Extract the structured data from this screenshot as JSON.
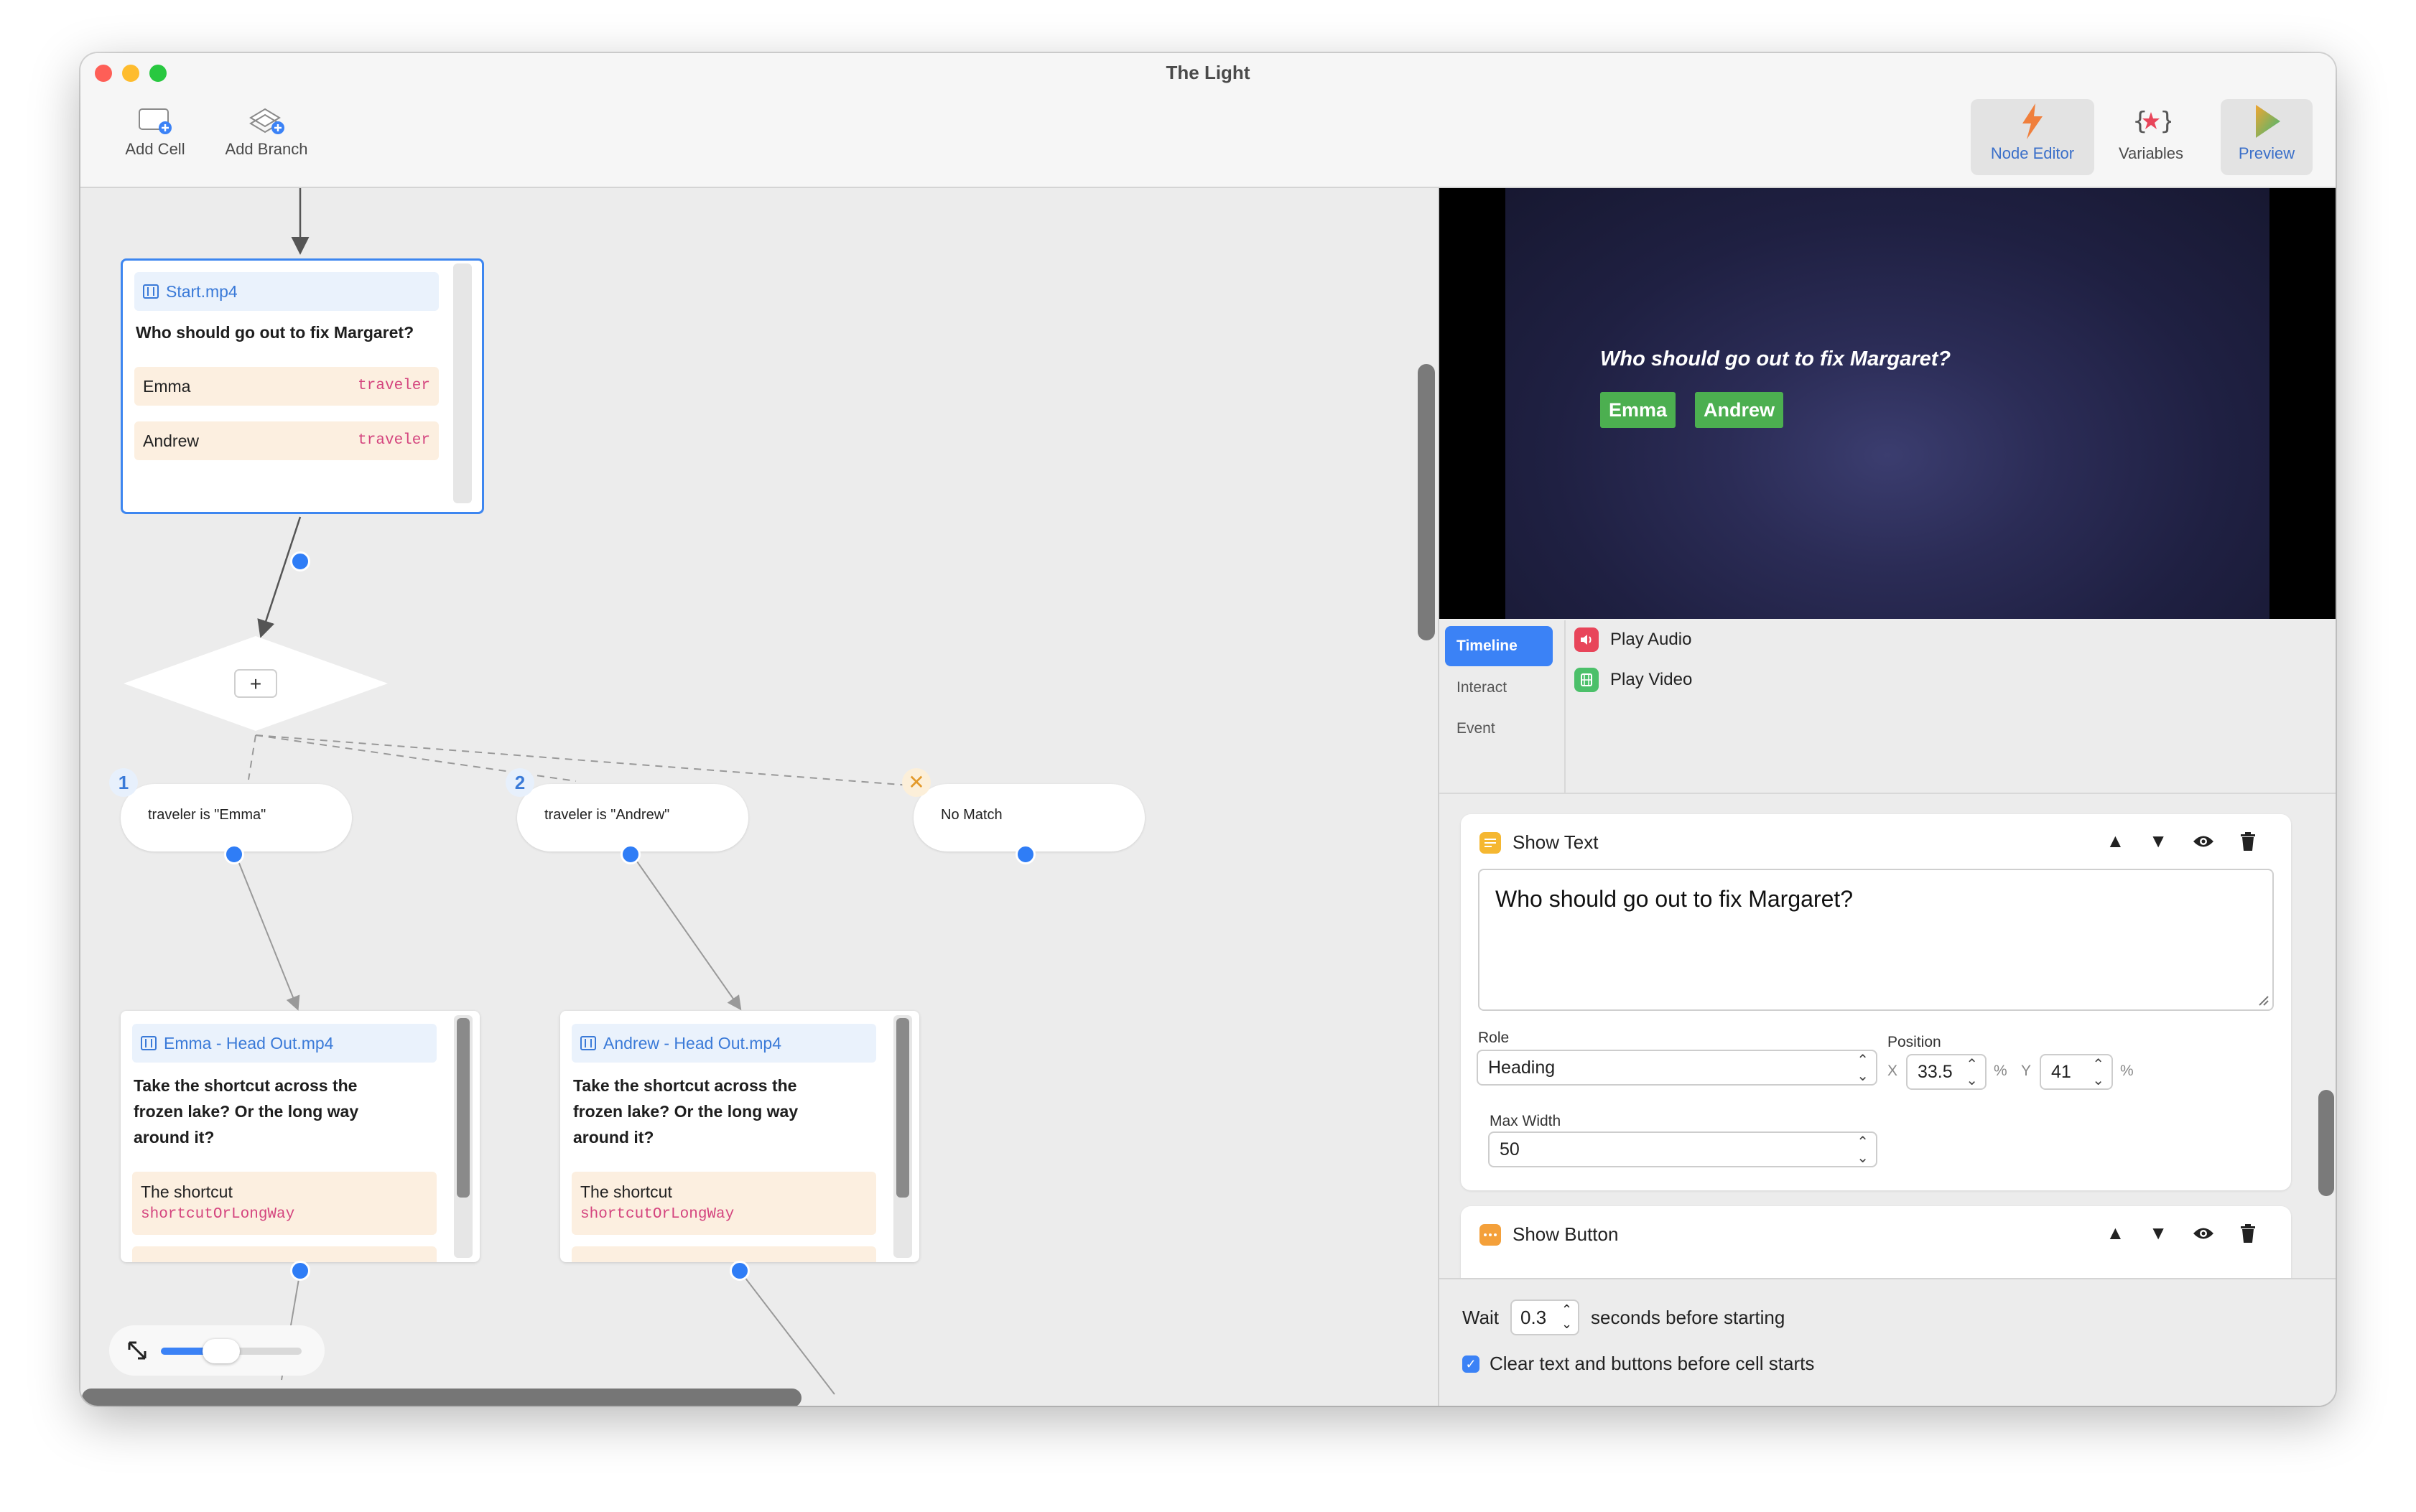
{
  "window": {
    "title": "The Light"
  },
  "toolbar": {
    "add_cell": "Add Cell",
    "add_branch": "Add Branch",
    "node_editor": "Node Editor",
    "variables": "Variables",
    "preview": "Preview"
  },
  "canvas": {
    "start_card": {
      "file": "Start.mp4",
      "question": "Who should go out to fix Margaret?",
      "answers": [
        {
          "label": "Emma",
          "var": "traveler"
        },
        {
          "label": "Andrew",
          "var": "traveler"
        }
      ]
    },
    "branch_plus": "+",
    "conditions": [
      {
        "number": "1",
        "text": "traveler is \"Emma\""
      },
      {
        "number": "2",
        "text": "traveler is \"Andrew\""
      },
      {
        "text": "No Match"
      }
    ],
    "emma_card": {
      "file": "Emma - Head Out.mp4",
      "question_lines": [
        "Take the shortcut across the",
        "frozen lake? Or the long way",
        "around it?"
      ],
      "answer": {
        "label": "The shortcut",
        "var": "shortcutOrLongWay"
      }
    },
    "andrew_card": {
      "file": "Andrew - Head Out.mp4",
      "question_lines": [
        "Take the shortcut across the",
        "frozen lake? Or the long way",
        "around it?"
      ],
      "answer": {
        "label": "The shortcut",
        "var": "shortcutOrLongWay"
      }
    },
    "zoom_level": 0.4
  },
  "preview": {
    "question": "Who should go out to fix Margaret?",
    "buttons": [
      "Emma",
      "Andrew"
    ]
  },
  "segments": {
    "items": [
      "Timeline",
      "Interact",
      "Event"
    ],
    "active": "Timeline"
  },
  "actions": [
    {
      "label": "Play Audio",
      "color": "#e8455a"
    },
    {
      "label": "Play Video",
      "color": "#4cc06a"
    }
  ],
  "inspector": {
    "show_text": {
      "title": "Show Text",
      "text": "Who should go out to fix Margaret?",
      "role_label": "Role",
      "role_value": "Heading",
      "position_label": "Position",
      "x_label": "X",
      "x_value": "33.5",
      "y_label": "Y",
      "y_value": "41",
      "pct": "%",
      "max_width_label": "Max Width",
      "max_width_value": "50"
    },
    "show_button": {
      "title": "Show Button"
    }
  },
  "footer": {
    "wait_label": "Wait",
    "wait_value": "0.3",
    "wait_suffix": "seconds before starting",
    "clear_label": "Clear text and buttons before cell starts",
    "clear_checked": true
  },
  "colors": {
    "accent": "#3b82f6",
    "answer_bg": "#fcefe0",
    "var_text": "#d4447e",
    "preview_button": "#4caf50"
  }
}
